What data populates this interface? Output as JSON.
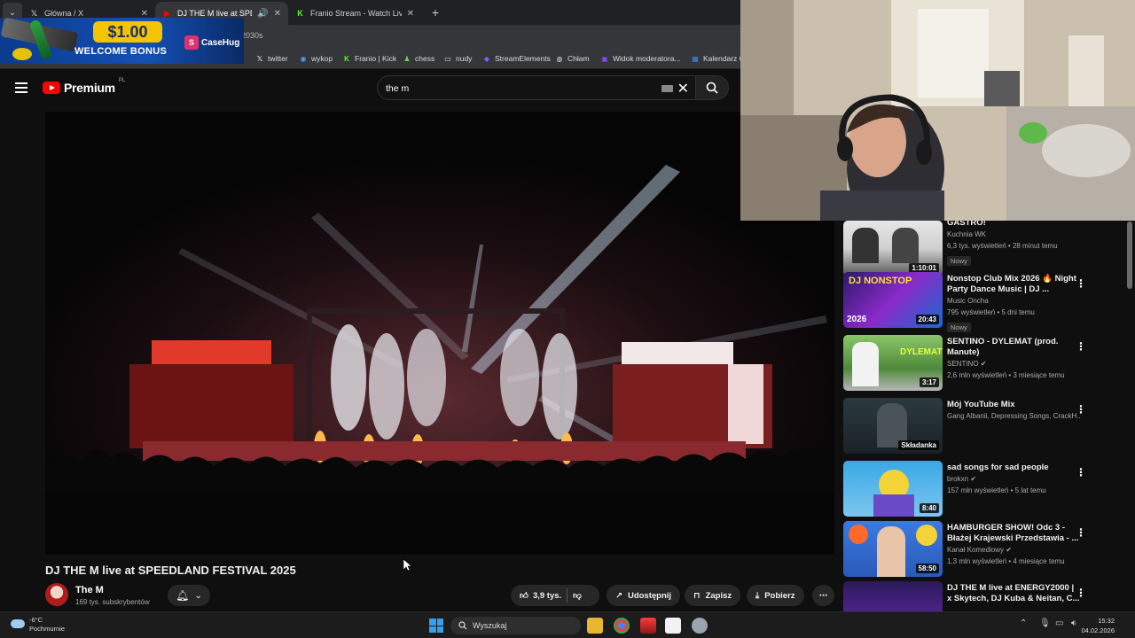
{
  "browser": {
    "tabs": [
      {
        "title": "Główna / X",
        "icon": "x-logo-icon",
        "active": false
      },
      {
        "title": "DJ THE M live at SPEEDLAND",
        "icon": "youtube-icon",
        "active": true
      },
      {
        "title": "Franio Stream - Watch Live on Kick",
        "icon": "kick-icon",
        "active": false
      }
    ],
    "url_fragment": "2030s",
    "bookmarks": [
      {
        "label": "twitter",
        "icon": "x-logo-icon"
      },
      {
        "label": "wykop",
        "icon": "wykop-icon"
      },
      {
        "label": "Franio | Kick",
        "icon": "kick-icon"
      },
      {
        "label": "chess",
        "icon": "pawn-icon"
      },
      {
        "label": "nudy",
        "icon": "folder-icon"
      },
      {
        "label": "StreamElements",
        "icon": "streamelements-icon"
      },
      {
        "label": "Chłam",
        "icon": "globe-icon"
      },
      {
        "label": "Widok moderatora...",
        "icon": "twitch-icon"
      },
      {
        "label": "Kalendarz G",
        "icon": "calendar-icon"
      }
    ]
  },
  "ad": {
    "price": "$1.00",
    "text": "WELCOME BONUS",
    "brand": "CaseHug"
  },
  "youtube": {
    "logo_text": "Premium",
    "region": "PL",
    "search_query": "the m",
    "video_title": "DJ THE M live at SPEEDLAND FESTIVAL 2025",
    "channel_name": "The M",
    "channel_subs": "169 tys. subskrybentów",
    "actions": {
      "likes": "3,9 tys.",
      "share": "Udostępnij",
      "save": "Zapisz",
      "download": "Pobierz"
    },
    "recommendations": [
      {
        "title": "GASTRO!",
        "channel": "Kuchnia WK",
        "meta": "6,3 tys. wyświetleń • 28 minut temu",
        "badge": "Nowy",
        "duration": "1:10:01",
        "verified": false
      },
      {
        "title": "Nonstop Club Mix 2026 🔥 Night Party Dance Music | DJ ...",
        "channel": "Music Oncha",
        "meta": "795 wyświetleń • 5 dni temu",
        "badge": "Nowy",
        "duration": "20:43",
        "verified": false
      },
      {
        "title": "SENTINO - DYLEMAT (prod. Manute)",
        "channel": "SENTINO",
        "meta": "2,6 mln wyświetleń • 3 miesiące temu",
        "badge": "",
        "duration": "3:17",
        "verified": true
      },
      {
        "title": "Mój YouTube Mix",
        "channel": "Gang Albanii, Depressing Songs, CrackH...",
        "meta": "",
        "badge": "",
        "duration": "Składanka",
        "verified": false
      },
      {
        "title": "sad songs for sad people",
        "channel": "brokxn",
        "meta": "157 mln wyświetleń • 5 lat temu",
        "badge": "",
        "duration": "8:40",
        "verified": true
      },
      {
        "title": "HAMBURGER SHOW! Odc 3 - Błażej Krajewski Przedstawia - ...",
        "channel": "Kanał Komediowy",
        "meta": "1,3 mln wyświetleń • 4 miesiące temu",
        "badge": "",
        "duration": "58:50",
        "verified": true
      },
      {
        "title": "DJ THE M live at ENERGY2000 | x Skytech, DJ Kuba & Neitan, C...",
        "channel": "",
        "meta": "",
        "badge": "",
        "duration": "",
        "verified": false
      }
    ]
  },
  "taskbar": {
    "temperature": "-6°C",
    "weather": "Pochmurnie",
    "search_placeholder": "Wyszukaj",
    "time": "15:32",
    "date": "04.02.2026"
  }
}
